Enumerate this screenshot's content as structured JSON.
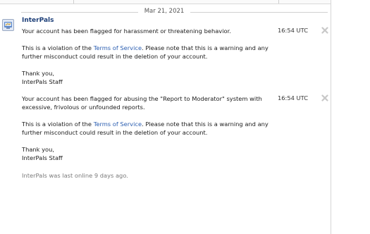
{
  "date_separator": "Mar 21, 2021",
  "sender": {
    "name": "InterPals",
    "avatar_icon": "site-avatar-icon"
  },
  "messages": [
    {
      "time": "16:54 UTC",
      "line1": "Your account has been flagged for harassment or threatening behavior.",
      "line2": "",
      "violation_prefix": "This is a violation of the ",
      "violation_link": "Terms of Service",
      "violation_suffix": ".  Please note that this is a warning and any",
      "violation_line2": "further misconduct could result in the deletion of your account.",
      "signoff": "Thank you,",
      "signature": "InterPals Staff"
    },
    {
      "time": "16:54 UTC",
      "line1": "Your account has been flagged for abusing the \"Report to Moderator\" system with",
      "line2": "excessive, frivolous or unfounded reports.",
      "violation_prefix": "This is a violation of the ",
      "violation_link": "Terms of Service",
      "violation_suffix": ".  Please note that this is a warning and any",
      "violation_line2": "further misconduct could result in the deletion of your account.",
      "signoff": "Thank you,",
      "signature": "InterPals Staff"
    }
  ],
  "last_online": "InterPals was last online 9 days ago.",
  "colors": {
    "link": "#2a5db0",
    "sender": "#1d3f78",
    "muted": "#7a7a7a"
  }
}
